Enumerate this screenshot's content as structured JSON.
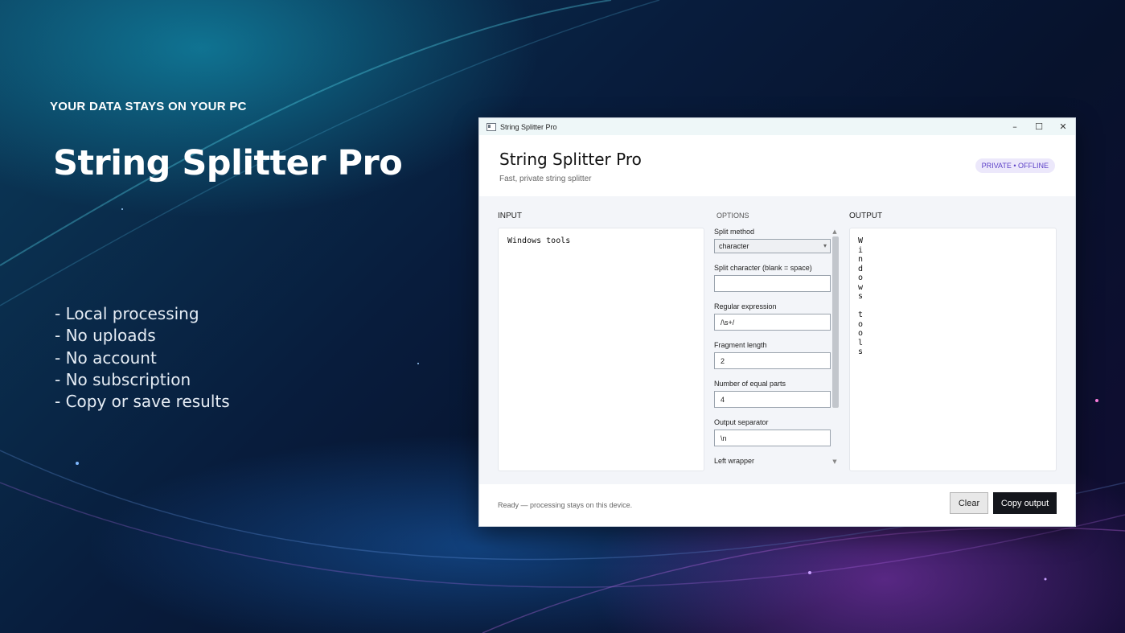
{
  "hero": {
    "eyebrow": "YOUR DATA STAYS ON YOUR PC",
    "title": "String Splitter Pro",
    "features": [
      "- Local processing",
      "- No uploads",
      "- No account",
      "- No subscription",
      "- Copy or save results"
    ]
  },
  "window": {
    "title": "String Splitter Pro",
    "controls": {
      "minimize": "–",
      "maximize": "☐",
      "close": "✕"
    },
    "app_icon": "app-window-icon"
  },
  "header": {
    "title": "String Splitter Pro",
    "subtitle": "Fast, private string splitter",
    "badge": "PRIVATE • OFFLINE"
  },
  "input": {
    "label": "INPUT",
    "value": "Windows tools"
  },
  "options": {
    "label": "OPTIONS",
    "split_method": {
      "label": "Split method",
      "value": "character"
    },
    "split_character": {
      "label": "Split character (blank = space)",
      "value": ""
    },
    "regex": {
      "label": "Regular expression",
      "value": "/\\s+/"
    },
    "fragment_length": {
      "label": "Fragment length",
      "value": "2"
    },
    "equal_parts": {
      "label": "Number of equal parts",
      "value": "4"
    },
    "output_separator": {
      "label": "Output separator",
      "value": "\\n"
    },
    "left_wrapper": {
      "label": "Left wrapper"
    }
  },
  "output": {
    "label": "OUTPUT",
    "lines": [
      "W",
      "i",
      "n",
      "d",
      "o",
      "w",
      "s",
      "",
      "t",
      "o",
      "o",
      "l",
      "s"
    ]
  },
  "footer": {
    "status": "Ready — processing stays on this device.",
    "clear_label": "Clear",
    "copy_label": "Copy output"
  },
  "colors": {
    "accent_dark": "#14161c",
    "badge_bg": "#ece8fb",
    "badge_text": "#5b3fc7"
  }
}
